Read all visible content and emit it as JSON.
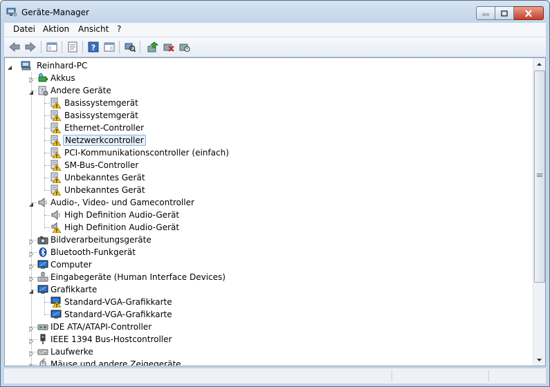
{
  "window": {
    "title": "Geräte-Manager",
    "icon": "device-manager-icon"
  },
  "menu": [
    {
      "label": "Datei",
      "name": "menu-datei"
    },
    {
      "label": "Aktion",
      "name": "menu-aktion"
    },
    {
      "label": "Ansicht",
      "name": "menu-ansicht"
    },
    {
      "label": "?",
      "name": "menu-help"
    }
  ],
  "toolbar": [
    {
      "name": "back-button",
      "icon": "back-arrow-icon"
    },
    {
      "name": "forward-button",
      "icon": "forward-arrow-icon"
    },
    {
      "name": "show-hide-console-tree-button",
      "icon": "console-tree-icon"
    },
    {
      "name": "properties-button",
      "icon": "properties-icon"
    },
    {
      "name": "help-button",
      "icon": "help-icon"
    },
    {
      "name": "action-pane-button",
      "icon": "action-pane-icon"
    },
    {
      "name": "scan-hardware-button",
      "icon": "scan-hardware-icon"
    },
    {
      "name": "update-driver-button",
      "icon": "update-driver-icon"
    },
    {
      "name": "uninstall-button",
      "icon": "uninstall-icon"
    },
    {
      "name": "disable-button",
      "icon": "disable-device-icon"
    }
  ],
  "tree": [
    {
      "label": "Reinhard-PC",
      "level": 0,
      "state": "expanded",
      "icon": "computer-icon"
    },
    {
      "label": "Akkus",
      "level": 1,
      "state": "collapsed",
      "icon": "battery-icon"
    },
    {
      "label": "Andere Geräte",
      "level": 1,
      "state": "expanded",
      "icon": "other-devices-icon"
    },
    {
      "label": "Basissystemgerät",
      "level": 2,
      "state": "leaf",
      "icon": "warning-device-icon"
    },
    {
      "label": "Basissystemgerät",
      "level": 2,
      "state": "leaf",
      "icon": "warning-device-icon"
    },
    {
      "label": "Ethernet-Controller",
      "level": 2,
      "state": "leaf",
      "icon": "warning-device-icon"
    },
    {
      "label": "Netzwerkcontroller",
      "level": 2,
      "state": "leaf",
      "icon": "warning-device-icon",
      "selected": true
    },
    {
      "label": "PCI-Kommunikationscontroller (einfach)",
      "level": 2,
      "state": "leaf",
      "icon": "warning-device-icon"
    },
    {
      "label": "SM-Bus-Controller",
      "level": 2,
      "state": "leaf",
      "icon": "warning-device-icon"
    },
    {
      "label": "Unbekanntes Gerät",
      "level": 2,
      "state": "leaf",
      "icon": "warning-device-icon"
    },
    {
      "label": "Unbekanntes Gerät",
      "level": 2,
      "state": "leaf",
      "icon": "warning-device-icon"
    },
    {
      "label": "Audio-, Video- und Gamecontroller",
      "level": 1,
      "state": "expanded",
      "icon": "speaker-icon"
    },
    {
      "label": "High Definition Audio-Gerät",
      "level": 2,
      "state": "leaf",
      "icon": "speaker-icon"
    },
    {
      "label": "High Definition Audio-Gerät",
      "level": 2,
      "state": "leaf",
      "icon": "speaker-warning-icon"
    },
    {
      "label": "Bildverarbeitungsgeräte",
      "level": 1,
      "state": "collapsed",
      "icon": "camera-icon"
    },
    {
      "label": "Bluetooth-Funkgerät",
      "level": 1,
      "state": "collapsed",
      "icon": "bluetooth-icon"
    },
    {
      "label": "Computer",
      "level": 1,
      "state": "collapsed",
      "icon": "monitor-icon"
    },
    {
      "label": "Eingabegeräte (Human Interface Devices)",
      "level": 1,
      "state": "collapsed",
      "icon": "hid-icon"
    },
    {
      "label": "Grafikkarte",
      "level": 1,
      "state": "expanded",
      "icon": "monitor-icon"
    },
    {
      "label": "Standard-VGA-Grafikkarte",
      "level": 2,
      "state": "leaf",
      "icon": "monitor-warning-icon"
    },
    {
      "label": "Standard-VGA-Grafikkarte",
      "level": 2,
      "state": "leaf",
      "icon": "monitor-icon"
    },
    {
      "label": "IDE ATA/ATAPI-Controller",
      "level": 1,
      "state": "collapsed",
      "icon": "ide-controller-icon"
    },
    {
      "label": "IEEE 1394 Bus-Hostcontroller",
      "level": 1,
      "state": "collapsed",
      "icon": "firewire-icon"
    },
    {
      "label": "Laufwerke",
      "level": 1,
      "state": "collapsed",
      "icon": "disk-drive-icon"
    },
    {
      "label": "Mäuse und andere Zeigegeräte",
      "level": 1,
      "state": "collapsed",
      "icon": "mouse-icon"
    }
  ],
  "colors": {
    "warning": "#f2c21a",
    "selection_bg": "#e4effb",
    "selection_border": "#8fb3dc",
    "close_button": "#c4402a"
  }
}
